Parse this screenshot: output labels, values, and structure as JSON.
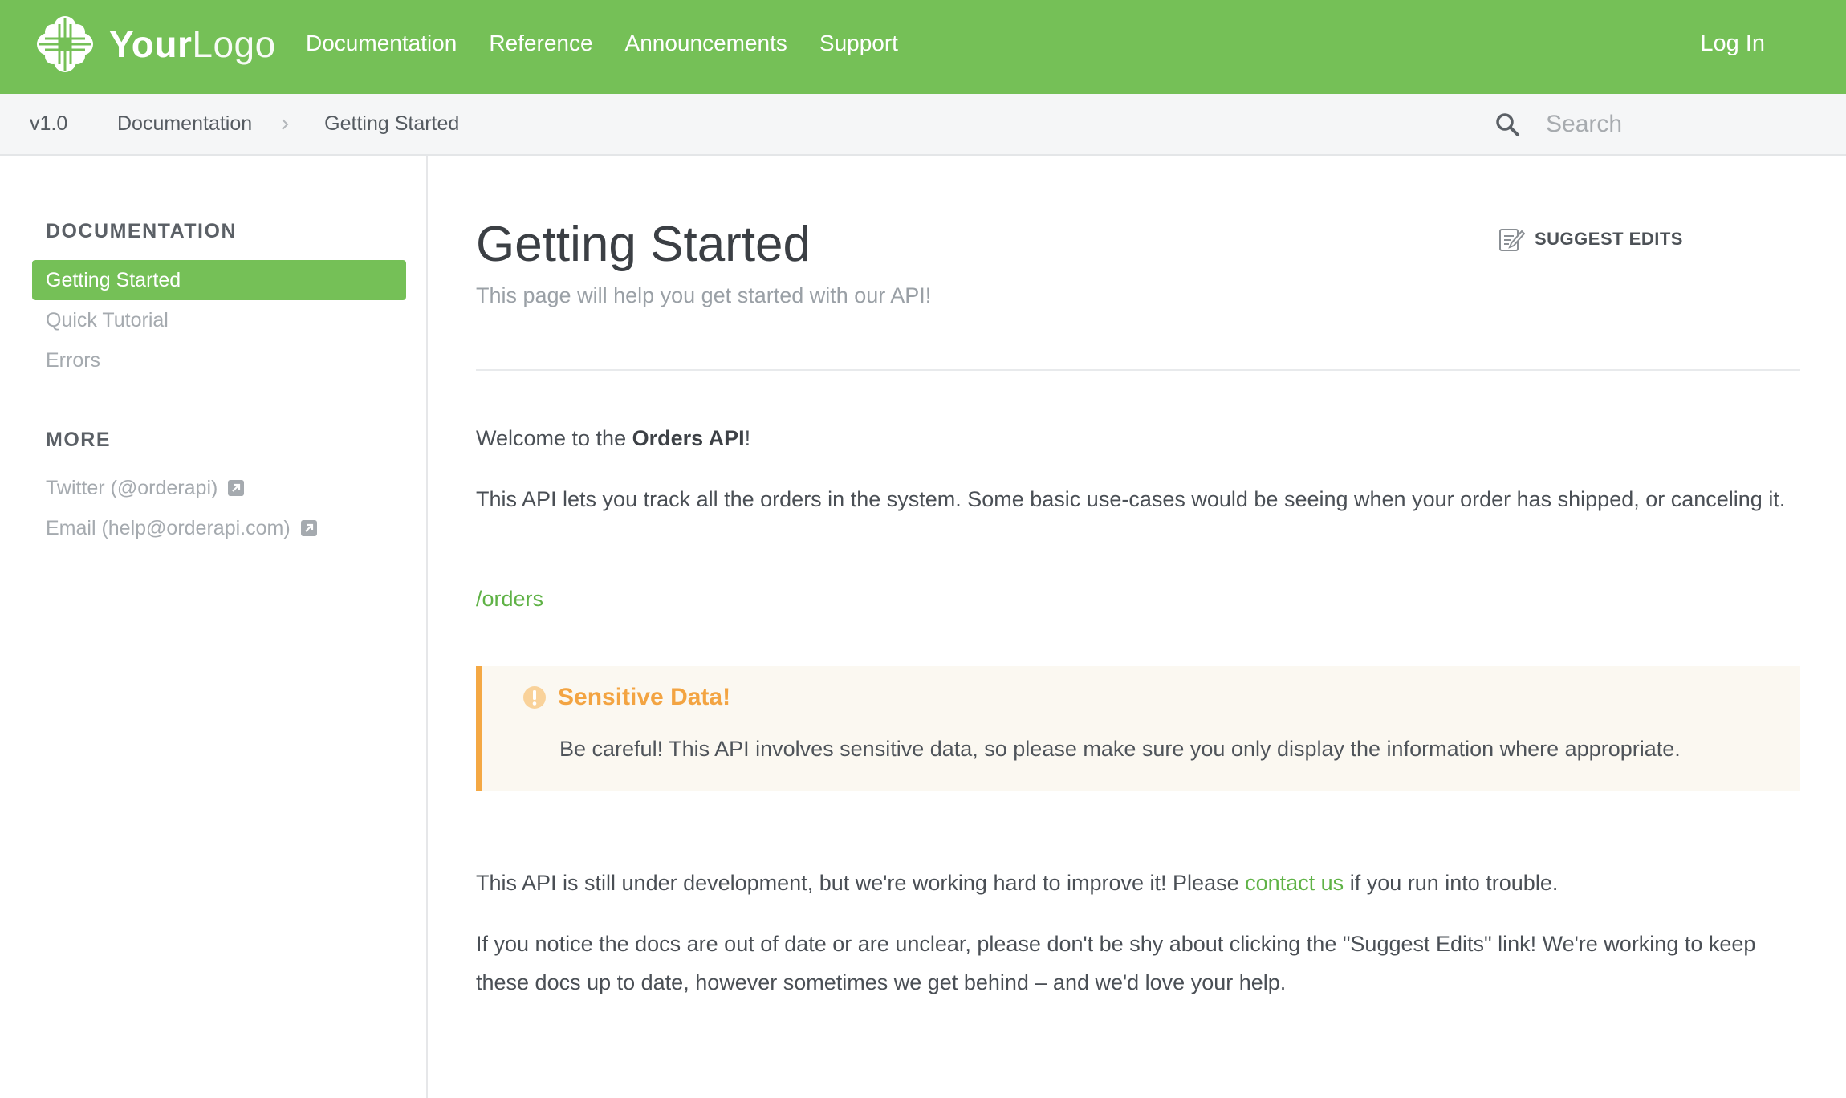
{
  "brand": {
    "logo_bold": "Your",
    "logo_light": "Logo",
    "accent_color": "#75c057"
  },
  "topnav": {
    "items": [
      {
        "label": "Documentation"
      },
      {
        "label": "Reference"
      },
      {
        "label": "Announcements"
      },
      {
        "label": "Support"
      }
    ],
    "login_label": "Log In"
  },
  "subbar": {
    "version": "v1.0",
    "breadcrumb": [
      "Documentation",
      "Getting Started"
    ],
    "search_placeholder": "Search",
    "search_icon": "search-icon"
  },
  "sidebar": {
    "sections": [
      {
        "heading": "DOCUMENTATION",
        "items": [
          {
            "label": "Getting Started",
            "active": true
          },
          {
            "label": "Quick Tutorial",
            "active": false
          },
          {
            "label": "Errors",
            "active": false
          }
        ]
      },
      {
        "heading": "MORE",
        "items": [
          {
            "label": "Twitter (@orderapi)",
            "icon": "external-link-icon"
          },
          {
            "label": "Email (help@orderapi.com)",
            "icon": "external-link-icon"
          }
        ]
      }
    ]
  },
  "page": {
    "title": "Getting Started",
    "subtitle": "This page will help you get started with our API!",
    "suggest_edits_label": "SUGGEST EDITS",
    "welcome_prefix": "Welcome to the ",
    "welcome_bold": "Orders API",
    "welcome_suffix": "!",
    "intro": "This API lets you track all the orders in the system. Some basic use-cases would be seeing when your order has shipped, or canceling it.",
    "orders_link": "/orders",
    "callout": {
      "title": "Sensitive Data!",
      "body": "Be careful! This API involves sensitive data, so please make sure you only display the information where appropriate.",
      "icon": "warning-icon",
      "color": "#f3a442"
    },
    "dev_prefix": "This API is still under development, but we're working hard to improve it! Please ",
    "dev_link": "contact us",
    "dev_suffix": " if you run into trouble.",
    "outdated": "If you notice the docs are out of date or are unclear, please don't be shy about clicking the \"Suggest Edits\" link! We're working to keep these docs up to date, however sometimes we get behind – and we'd love your help."
  }
}
